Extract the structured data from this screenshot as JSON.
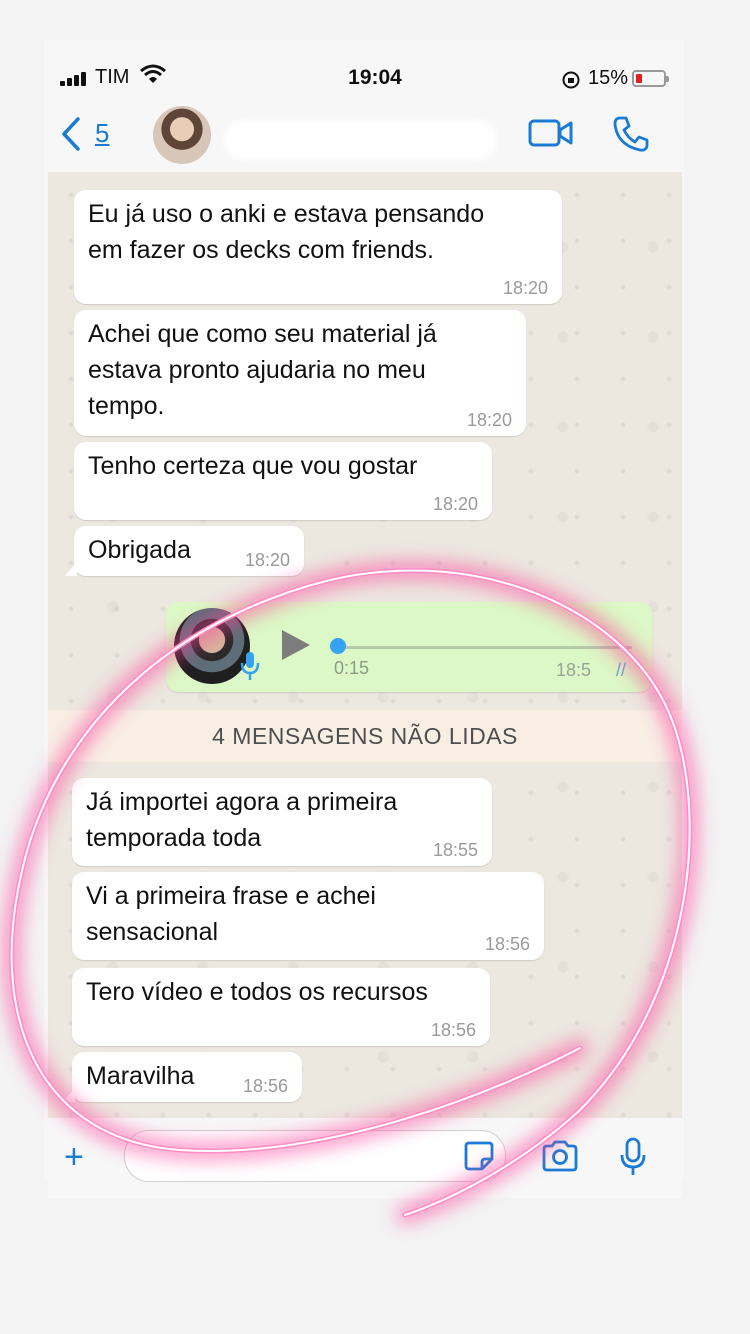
{
  "status_bar": {
    "carrier": "TIM",
    "time": "19:04",
    "battery_percent": "15%"
  },
  "header": {
    "back_count": "5",
    "contact_name": ""
  },
  "messages_read": [
    {
      "text": "Eu já uso o anki e estava pensando\nem fazer os decks com friends.",
      "time": "18:20"
    },
    {
      "text": "Achei que como seu material já\nestava pronto ajudaria no meu\ntempo.",
      "time": "18:20"
    },
    {
      "text": "Tenho certeza que vou gostar",
      "time": "18:20"
    },
    {
      "text": "Obrigada",
      "time": "18:20"
    }
  ],
  "voice_message": {
    "duration": "0:15",
    "time": "18:5",
    "ticks": "//"
  },
  "unread_banner": "4 MENSAGENS NÃO LIDAS",
  "messages_unread": [
    {
      "text": "Já importei agora a primeira\ntemporada toda",
      "time": "18:55"
    },
    {
      "text": "Vi a primeira frase e achei\nsensacional",
      "time": "18:56"
    },
    {
      "text": "Tero vídeo e todos os recursos",
      "time": "18:56"
    },
    {
      "text": "Maravilha",
      "time": "18:56"
    }
  ],
  "input_bar": {
    "plus": "+",
    "message_placeholder": ""
  },
  "colors": {
    "accent": "#1b7bd4",
    "voice_bubble": "#dcf8c6",
    "unread_banner": "#f8eee4",
    "neon_pink": "#ff4fa3",
    "battery_low": "#e0211d"
  }
}
